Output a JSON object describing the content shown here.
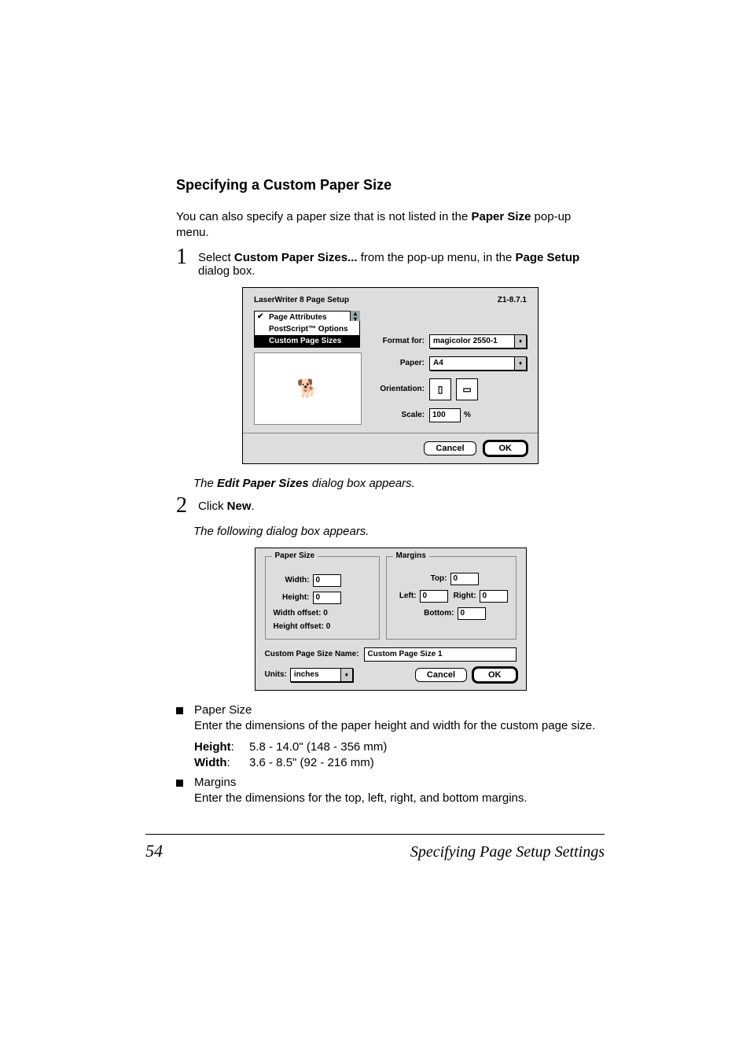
{
  "heading": "Specifying a Custom Paper Size",
  "intro_pre": "You can also specify a paper size that is not listed in the ",
  "intro_bold": "Paper Size",
  "intro_post": " pop-up menu.",
  "step1": {
    "num": "1",
    "a": "Select ",
    "b": "Custom Paper Sizes...",
    "c": " from the pop-up menu, in the ",
    "d": "Page Setup",
    "e": " dialog box."
  },
  "dlg1": {
    "title": "LaserWriter 8 Page Setup",
    "version": "Z1-8.7.1",
    "list": [
      "Page Attributes",
      "PostScript™ Options",
      "Custom Page Sizes"
    ],
    "format_label": "Format for:",
    "format_value": "magicolor 2550-1",
    "paper_label": "Paper:",
    "paper_value": "A4",
    "orientation_label": "Orientation:",
    "scale_label": "Scale:",
    "scale_value": "100",
    "scale_unit": "%",
    "cancel": "Cancel",
    "ok": "OK"
  },
  "caption1_a": "The ",
  "caption1_b": "Edit Paper Sizes",
  "caption1_c": " dialog box appears.",
  "step2": {
    "num": "2",
    "a": "Click ",
    "b": "New",
    "c": "."
  },
  "caption2": "The following dialog box appears.",
  "dlg2": {
    "group1_title": "Paper Size",
    "width_label": "Width:",
    "width_value": "0",
    "height_label": "Height:",
    "height_value": "0",
    "woff": "Width offset:  0",
    "hoff": "Height offset:  0",
    "group2_title": "Margins",
    "top_label": "Top:",
    "top_value": "0",
    "left_label": "Left:",
    "left_value": "0",
    "right_label": "Right:",
    "right_value": "0",
    "bottom_label": "Bottom:",
    "bottom_value": "0",
    "name_label": "Custom Page Size Name:",
    "name_value": "Custom Page Size 1",
    "units_label": "Units:",
    "units_value": "inches",
    "cancel": "Cancel",
    "ok": "OK"
  },
  "bullets": {
    "b1_title": "Paper Size",
    "b1_body": "Enter the dimensions of the paper height and width for the custom page size.",
    "height_k": "Height",
    "height_v": "5.8 - 14.0\" (148 - 356 mm)",
    "width_k": "Width",
    "width_v": "3.6 - 8.5\" (92 - 216 mm)",
    "b2_title": "Margins",
    "b2_body": "Enter the dimensions for the top, left, right, and bottom margins."
  },
  "footer": {
    "page": "54",
    "title": "Specifying Page Setup Settings"
  }
}
